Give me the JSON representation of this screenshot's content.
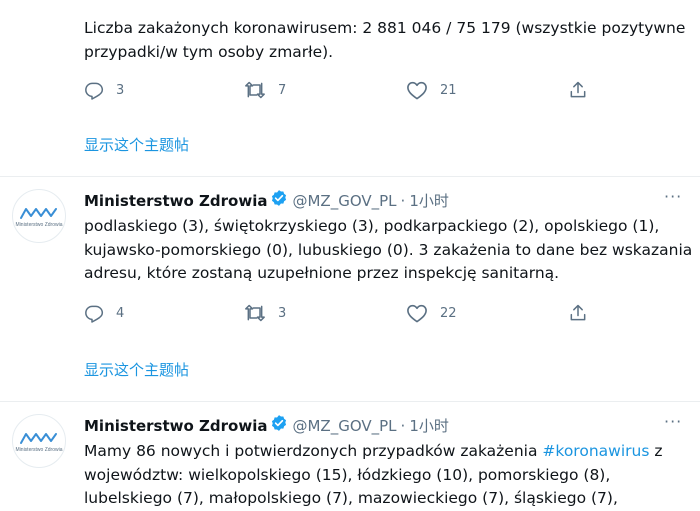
{
  "tweets": [
    {
      "text": "Liczba zakażonych koronawirusem: 2 881 046 / 75 179 (wszystkie pozytywne przypadki/w tym osoby zmarłe).",
      "replies": "3",
      "retweets": "7",
      "likes": "21",
      "thread_link": "显示这个主题帖"
    },
    {
      "author_name": "Ministerstwo Zdrowia",
      "handle": "@MZ_GOV_PL",
      "separator": "·",
      "time": "1小时",
      "avatar_caption": "Ministerstwo Zdrowia",
      "text": "podlaskiego (3), świętokrzyskiego (3), podkarpackiego (2), opolskiego (1), kujawsko-pomorskiego (0), lubuskiego (0). 3 zakażenia to dane bez wskazania adresu, które zostaną uzupełnione przez inspekcję sanitarną.",
      "replies": "4",
      "retweets": "3",
      "likes": "22",
      "thread_link": "显示这个主题帖"
    },
    {
      "author_name": "Ministerstwo Zdrowia",
      "handle": "@MZ_GOV_PL",
      "separator": "·",
      "time": "1小时",
      "avatar_caption": "Ministerstwo Zdrowia",
      "text_before": "Mamy 86 nowych i potwierdzonych przypadków zakażenia ",
      "hashtag": "#koronawirus",
      "text_after": " z województw: wielkopolskiego (15), łódzkiego (10), pomorskiego (8), lubelskiego (7), małopolskiego (7), mazowieckiego (7), śląskiego (7),"
    }
  ],
  "colors": {
    "link": "#1b95e0",
    "muted": "#5b7083",
    "verified": "#1da1f2",
    "logo": "#3a8fd6"
  },
  "icons": [
    "reply-icon",
    "retweet-icon",
    "like-icon",
    "share-icon",
    "verified-badge-icon",
    "more-icon"
  ]
}
